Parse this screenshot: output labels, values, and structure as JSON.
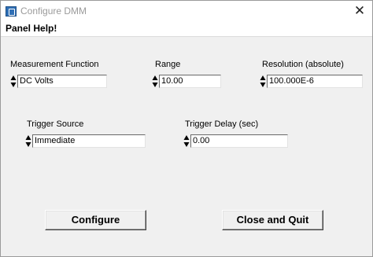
{
  "window": {
    "title": "Configure DMM"
  },
  "menu": {
    "panel_help": "Panel Help!"
  },
  "fields": {
    "measurement_function": {
      "label": "Measurement Function",
      "value": "DC Volts"
    },
    "range": {
      "label": "Range",
      "value": "10.00"
    },
    "resolution": {
      "label": "Resolution (absolute)",
      "value": "100.000E-6"
    },
    "trigger_source": {
      "label": "Trigger Source",
      "value": "Immediate"
    },
    "trigger_delay": {
      "label": "Trigger Delay (sec)",
      "value": "0.00"
    }
  },
  "buttons": {
    "configure": "Configure",
    "close_quit": "Close and Quit"
  },
  "icons": {
    "app": "app-icon",
    "close": "close-icon",
    "spinner": "up-down-arrow-icon"
  }
}
